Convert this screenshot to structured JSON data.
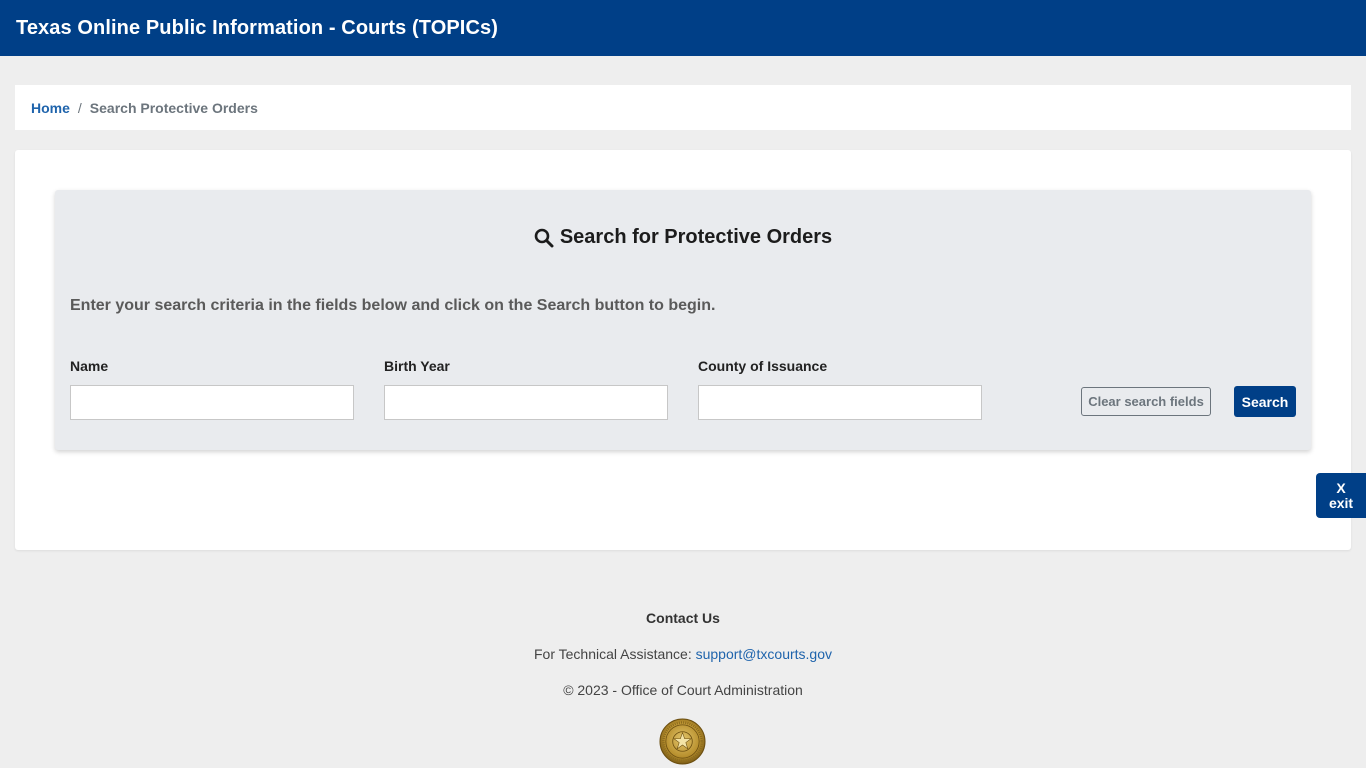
{
  "header": {
    "title": "Texas Online Public Information - Courts (TOPICs)"
  },
  "breadcrumb": {
    "home_label": "Home",
    "separator": "/",
    "current_label": "Search Protective Orders"
  },
  "search": {
    "heading": "Search for Protective Orders",
    "instructions": "Enter your search criteria in the fields below and click on the Search button to begin.",
    "fields": [
      {
        "label": "Name",
        "value": "",
        "placeholder": ""
      },
      {
        "label": "Birth Year",
        "value": "",
        "placeholder": ""
      },
      {
        "label": "County of Issuance",
        "value": "",
        "placeholder": ""
      }
    ],
    "clear_label": "Clear search fields",
    "search_label": "Search"
  },
  "exit": {
    "x_label": "X",
    "label": "exit"
  },
  "footer": {
    "contact_heading": "Contact Us",
    "tech_prefix": "For Technical Assistance:",
    "support_email": "support@txcourts.gov",
    "copyright": "© 2023 - Office of Court Administration"
  },
  "colors": {
    "brand": "#003f87",
    "link": "#1f64ac",
    "panel_bg": "#e9ebee",
    "page_bg": "#eeeeee"
  },
  "icons": {
    "heading_icon": "search-icon",
    "footer_seal": "texas-seal-icon"
  }
}
